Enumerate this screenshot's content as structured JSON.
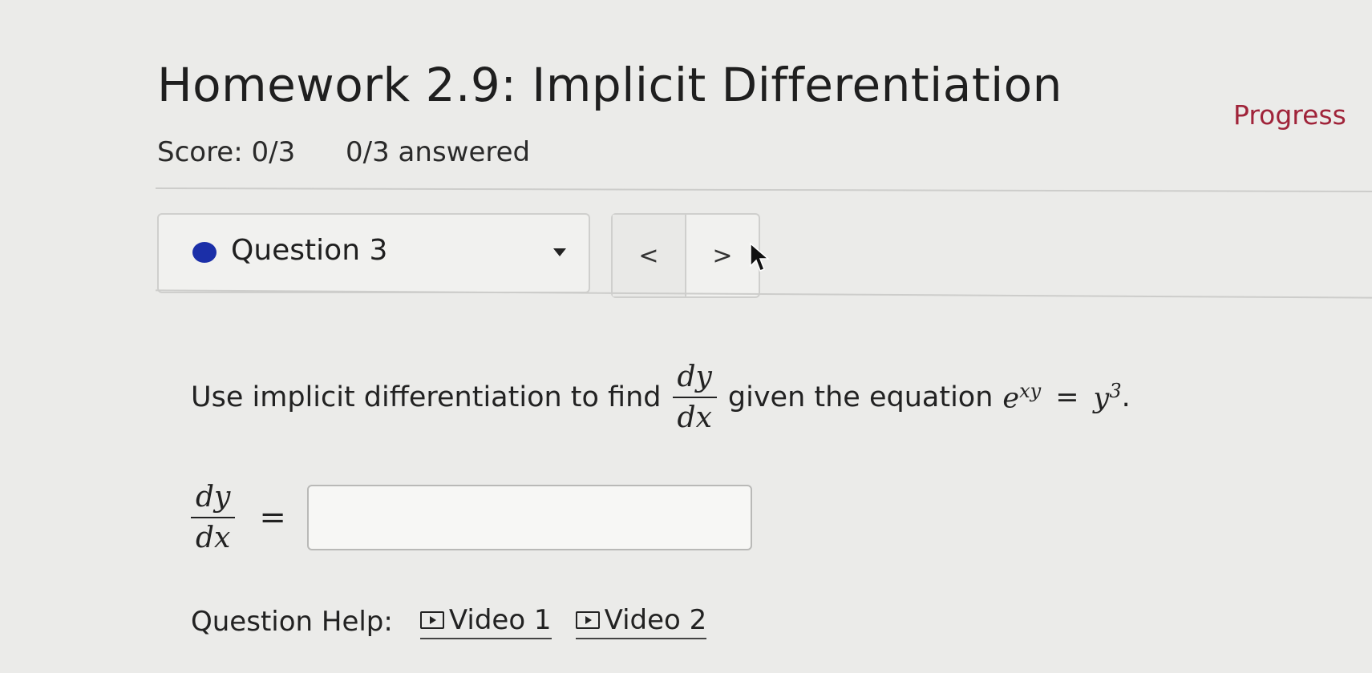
{
  "header": {
    "title": "Homework 2.9: Implicit Differentiation",
    "progress_label": "Progress"
  },
  "score": {
    "score_text": "Score: 0/3",
    "answered_text": "0/3 answered"
  },
  "question_nav": {
    "selected": "Question 3",
    "status_color": "#1b2fa8",
    "prev_label": "<",
    "next_label": ">"
  },
  "question": {
    "prompt_before": "Use implicit differentiation to find",
    "deriv_num": "dy",
    "deriv_den": "dx",
    "prompt_middle": "given the equation",
    "equation_base": "e",
    "equation_exp": "xy",
    "equals": "=",
    "rhs_base": "y",
    "rhs_exp": "3",
    "period": "."
  },
  "answer": {
    "lhs_num": "dy",
    "lhs_den": "dx",
    "equals": "=",
    "value": ""
  },
  "help": {
    "label": "Question Help:",
    "videos": [
      "Video 1",
      "Video 2"
    ]
  },
  "colors": {
    "progress_link": "#a0243a"
  }
}
